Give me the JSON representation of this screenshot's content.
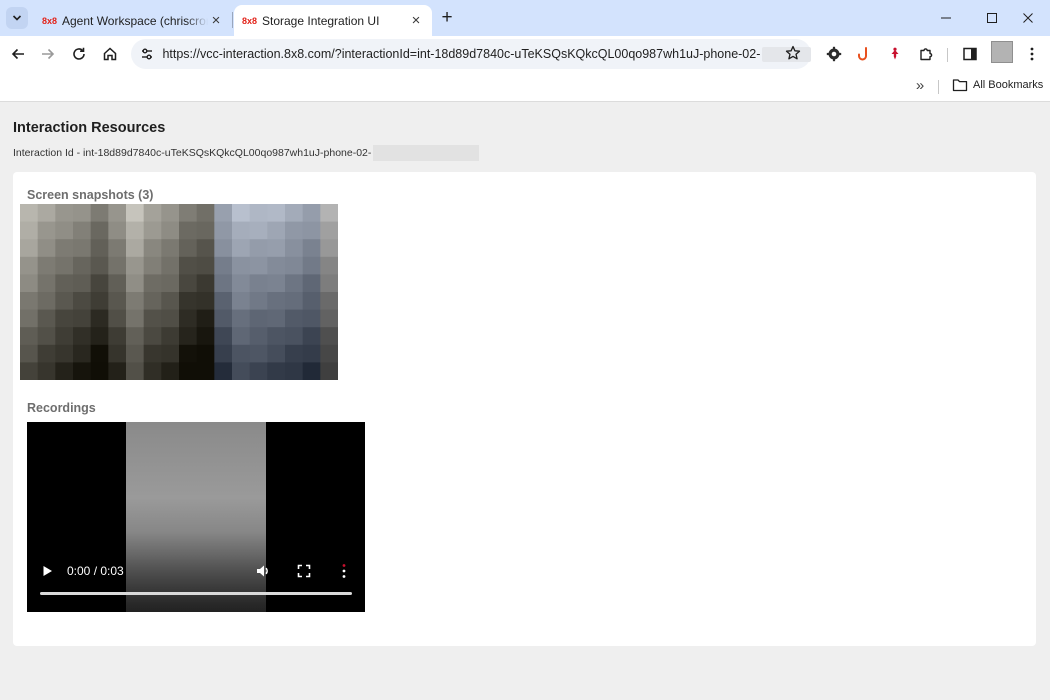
{
  "tabs": [
    {
      "favicon": "8x8",
      "title": "Agent Workspace (chriscrombie",
      "active": false
    },
    {
      "favicon": "8x8",
      "title": "Storage Integration UI",
      "active": true
    }
  ],
  "toolbar": {
    "url": "https://vcc-interaction.8x8.com/?interactionId=int-18d89d7840c-uTeKSQsKQkcQL00qo987wh1uJ-phone-02-"
  },
  "bookmarks": {
    "all_bookmarks": "All Bookmarks"
  },
  "page": {
    "title": "Interaction Resources",
    "interaction_id_label": "Interaction Id - int-18d89d7840c-uTeKSQsKQkcQL00qo987wh1uJ-phone-02-",
    "snapshots_heading": "Screen snapshots (3)",
    "recordings_heading": "Recordings",
    "video_time": "0:00 / 0:03",
    "video_progress": 0
  },
  "icons": {
    "tab_search": "chevron-down-icon",
    "back": "arrow-left-icon",
    "forward": "arrow-right-icon",
    "reload": "reload-icon",
    "home": "home-icon",
    "site_info": "tune-icon",
    "bookmark": "star-icon",
    "extensions": [
      "gear-extension-icon",
      "hook-extension-icon",
      "pin-extension-icon",
      "puzzle-icon"
    ],
    "side_panel": "side-panel-icon",
    "menu": "kebab-menu-icon",
    "window": [
      "minimize-icon",
      "maximize-icon",
      "close-icon"
    ],
    "video_controls": [
      "play-icon",
      "volume-icon",
      "fullscreen-icon",
      "more-options-icon"
    ]
  },
  "colors": {
    "tabstrip": "#d3e3fd",
    "brand_red": "#e2231a",
    "page_background": "#efefef"
  }
}
